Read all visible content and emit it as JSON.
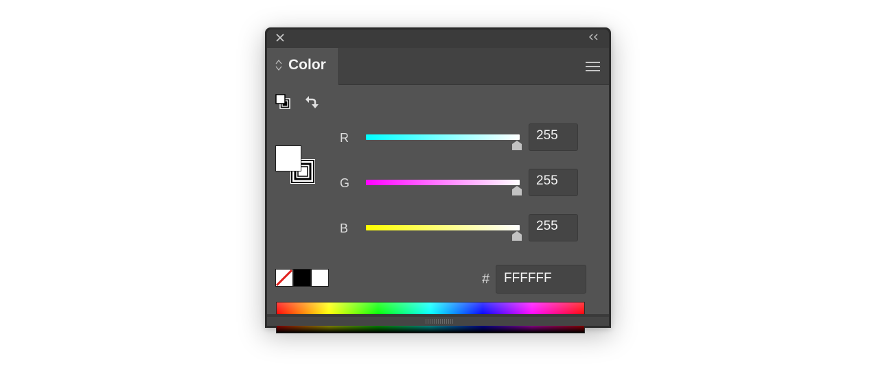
{
  "panel": {
    "tab_title": "Color",
    "icons": {
      "close": "close-icon",
      "collapse": "collapse-icon",
      "tab_arrows": "up-down-arrows-icon",
      "menu": "hamburger-menu-icon",
      "default_fill_stroke": "default-fill-stroke-icon",
      "swap": "swap-fill-stroke-icon"
    }
  },
  "channels": [
    {
      "label": "R",
      "value": "255",
      "level": 1.0,
      "gradient_color": "#00ffff"
    },
    {
      "label": "G",
      "value": "255",
      "level": 1.0,
      "gradient_color": "#ff00ff"
    },
    {
      "label": "B",
      "value": "255",
      "level": 1.0,
      "gradient_color": "#ffff00"
    }
  ],
  "hex": {
    "sign": "#",
    "value": "FFFFFF"
  },
  "fill_color": "#ffffff",
  "stroke_color": "#000000",
  "quick_swatches": [
    "none",
    "#000000",
    "#ffffff"
  ],
  "colors": {
    "panel_bg": "#535353",
    "field_bg": "#454545",
    "title_bg": "#3b3b3b"
  }
}
